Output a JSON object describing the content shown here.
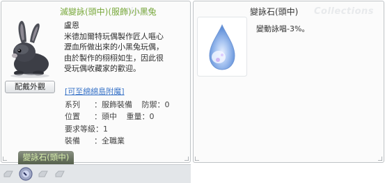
{
  "left_window": {
    "title": "滅變詠(頭中)(服飾)小黑兔",
    "watermark": "tions",
    "view_button": "配戴外觀",
    "description": [
      "盧恩",
      "米德加爾特玩偶製作匠人嘔心",
      "瀝血所做出來的小黑兔玩偶，",
      "由於製作的栩栩如生，因此很",
      "受玩偶收藏家的歡迎。"
    ],
    "link": "[可至綿綿島附魔]",
    "props": {
      "series_label": "系列",
      "series_value": "服飾裝備",
      "defense_label": "防禦",
      "defense_value": "0",
      "position_label": "位置",
      "position_value": "頭中",
      "weight_label": "重量",
      "weight_value": "0",
      "level_label": "要求等級",
      "level_value": "1",
      "equip_label": "裝備",
      "equip_value": "全職業"
    },
    "tab_label": "變詠石(頭中)"
  },
  "right_window": {
    "title": "變詠石(頭中)",
    "watermark": "Collections",
    "description": "變動詠唱-3%。"
  },
  "colors": {
    "title_green": "#78a83a",
    "link_blue": "#3a74c8",
    "tab_bg": "#5e6856",
    "tab_text": "#d8efac"
  }
}
